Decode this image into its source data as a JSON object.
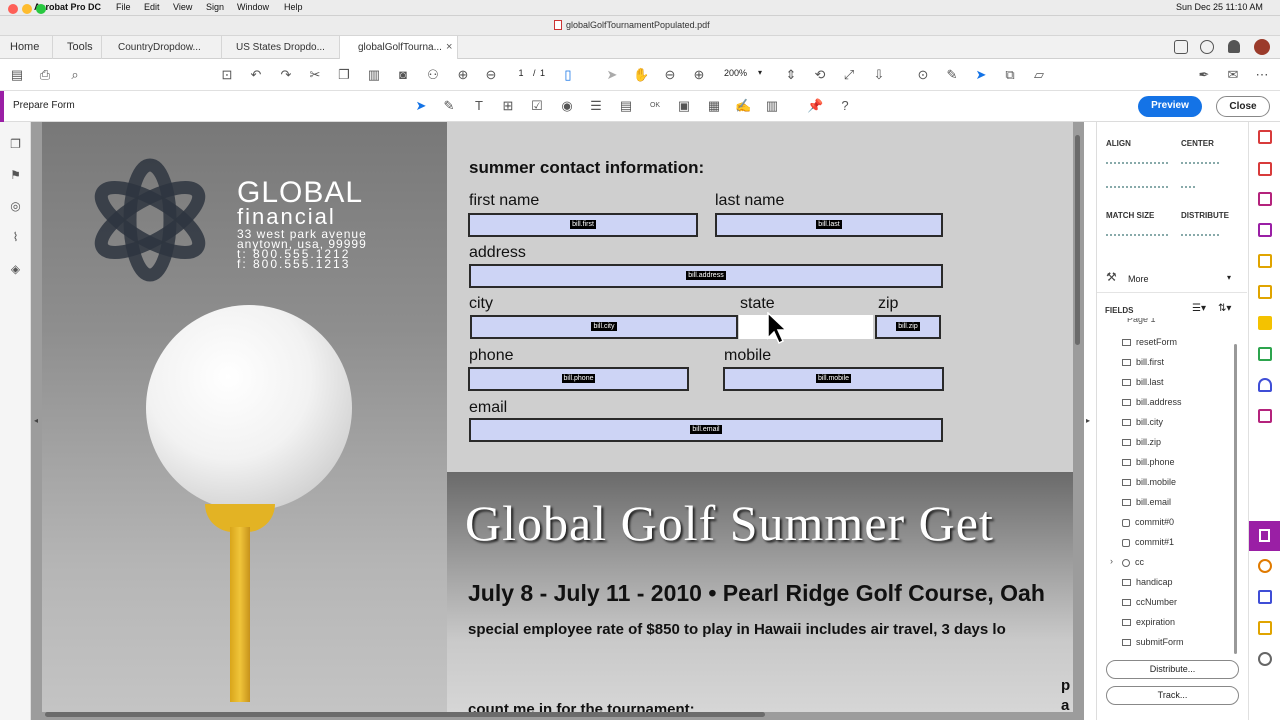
{
  "menubar": {
    "app": "Acrobat Pro DC",
    "items": [
      "File",
      "Edit",
      "View",
      "Sign",
      "Window",
      "Help"
    ],
    "datetime": "Sun Dec 25  11:10 AM"
  },
  "window": {
    "title": "globalGolfTournamentPopulated.pdf"
  },
  "tabs": {
    "home": "Home",
    "tools": "Tools",
    "docs": [
      "CountryDropdow...",
      "US States Dropdo...",
      "globalGolfTourna..."
    ],
    "close": "×"
  },
  "toolbar": {
    "page_current": "1",
    "page_sep": "/",
    "page_total": "1",
    "zoom": "200%"
  },
  "formbar": {
    "title": "Prepare Form",
    "preview": "Preview",
    "close": "Close"
  },
  "form": {
    "heading": "summer contact information:",
    "labels": {
      "first": "first name",
      "last": "last name",
      "address": "address",
      "city": "city",
      "state": "state",
      "zip": "zip",
      "phone": "phone",
      "mobile": "mobile",
      "email": "email"
    },
    "fields": {
      "first": "bill.first",
      "last": "bill.last",
      "address": "bill.address",
      "city": "bill.city",
      "zip": "bill.zip",
      "phone": "bill.phone",
      "mobile": "bill.mobile",
      "email": "bill.email"
    }
  },
  "brand": {
    "name1": "GLOBAL",
    "name2": "financial",
    "addr1": "33 west park avenue",
    "addr2": "anytown, usa, 99999",
    "tel": "t: 800.555.1212",
    "fax": "f: 800.555.1213"
  },
  "promo": {
    "title": "Global Golf Summer Get",
    "dates": "July 8 - July 11 - 2010 • Pearl Ridge Golf Course, Oah",
    "rate": "special employee rate of $850 to play in Hawaii includes  air travel, 3 days lo",
    "countme": "count me in for the tournament:",
    "p": "p",
    "a": "a"
  },
  "panel": {
    "align": "ALIGN",
    "center": "CENTER",
    "match": "MATCH SIZE",
    "distribute": "DISTRIBUTE",
    "more": "More",
    "fields": "FIELDS",
    "page_partial": "Page 1",
    "field_list": [
      "resetForm",
      "bill.first",
      "bill.last",
      "bill.address",
      "bill.city",
      "bill.zip",
      "bill.phone",
      "bill.mobile",
      "bill.email",
      "commit#0",
      "commit#1",
      "cc",
      "handicap",
      "ccNumber",
      "expiration",
      "submitForm"
    ],
    "distribute_btn": "Distribute...",
    "track_btn": "Track..."
  },
  "colors": {
    "preview_blue": "#1473e6",
    "form_accent": "#9a1fa5",
    "field_fill": "#cdd4f5"
  }
}
